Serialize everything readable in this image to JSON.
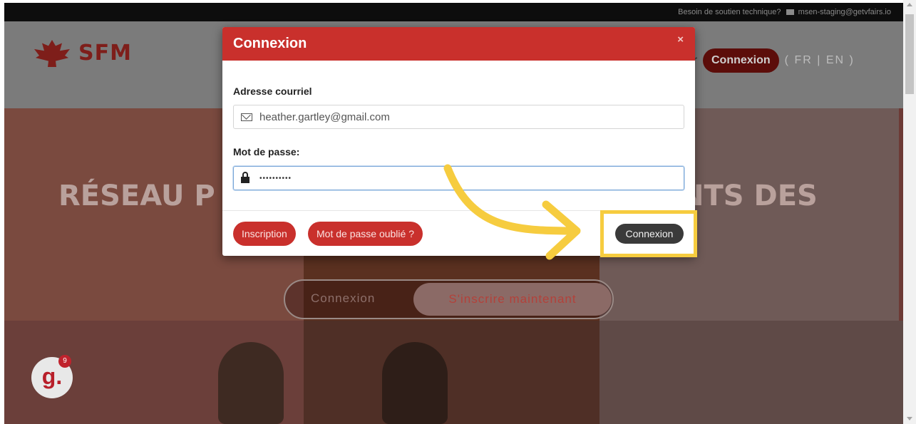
{
  "topbar": {
    "support_text": "Besoin de soutien technique?",
    "email": "msen-staging@getvfairs.io",
    "mail_icon": "envelope-icon"
  },
  "header": {
    "logo_text": "SFM",
    "nav_fragment": "ur",
    "nav_login": "Connexion",
    "languages": "( FR | EN )"
  },
  "hero": {
    "title_left": "RÉSEAU P",
    "title_right": "NTS DES",
    "cta_login": "Connexion",
    "cta_signup": "S'inscrire maintenant"
  },
  "badge": {
    "letter": "g.",
    "count": "9"
  },
  "modal": {
    "title": "Connexion",
    "close": "×",
    "email_label": "Adresse courriel",
    "email_value": "heather.gartley@gmail.com",
    "password_label": "Mot de passe:",
    "password_value": "••••••••••",
    "signup_button": "Inscription",
    "forgot_button": "Mot de passe oublié ?",
    "submit_button": "Connexion"
  },
  "colors": {
    "brand_red": "#c9302c",
    "highlight_yellow": "#f6cc3f",
    "dark_button": "#3a3a3a"
  }
}
